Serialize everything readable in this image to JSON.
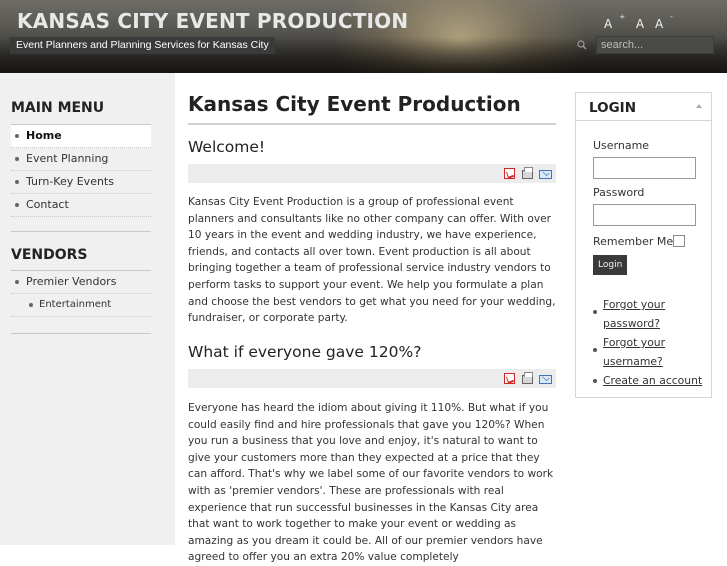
{
  "header": {
    "site_title": "KANSAS CITY EVENT PRODUCTION",
    "slogan": "Event Planners and Planning Services for Kansas City",
    "font_controls": {
      "increase": "A",
      "increase_sup": "+",
      "reset": "A",
      "decrease": "A",
      "decrease_sup": "-"
    },
    "search": {
      "placeholder": "search..."
    }
  },
  "left": {
    "main_menu": {
      "title": "MAIN MENU",
      "items": [
        {
          "label": "Home",
          "active": true
        },
        {
          "label": "Event Planning"
        },
        {
          "label": "Turn-Key Events"
        },
        {
          "label": "Contact"
        }
      ]
    },
    "vendors": {
      "title": "VENDORS",
      "items": [
        {
          "label": "Premier Vendors"
        },
        {
          "label": "Entertainment",
          "sub": true
        }
      ]
    }
  },
  "main": {
    "page_title": "Kansas City Event Production",
    "articles": [
      {
        "title": "Welcome!",
        "tools": [
          "pdf-icon",
          "print-icon",
          "email-icon"
        ],
        "text": "Kansas City Event Production is a group of professional event planners and consultants like no other company can offer. With over 10 years in the event and wedding industry, we have experience, friends, and contacts all over town. Event production is all about bringing together a team of professional service industry vendors to perform tasks to support your event. We help you formulate a plan and choose the best vendors to get what you need for your wedding, fundraiser, or corporate party."
      },
      {
        "title": "What if everyone gave 120%?",
        "tools": [
          "pdf-icon",
          "print-icon",
          "email-icon"
        ],
        "text": "Everyone has heard the idiom about giving it 110%. But what if you could easily find and hire professionals that gave you 120%? When you run a business that you love and enjoy, it's natural to want to give your customers more than they expected at a price that they can afford. That's why we label some of our favorite vendors to work with as 'premier vendors'. These are professionals with real experience that run successful businesses in the Kansas City area that want to work together to make your event or wedding as amazing as you dream it could be. All of our premier vendors have agreed to offer you an extra 20% value completely"
      }
    ]
  },
  "login": {
    "title": "LOGIN",
    "username_label": "Username",
    "password_label": "Password",
    "remember_label": "Remember Me",
    "button_label": "Login",
    "links": [
      {
        "line1": "Forgot your",
        "line2": "password?"
      },
      {
        "line1": "Forgot your",
        "line2": "username?"
      },
      {
        "line1": "Create an account"
      }
    ]
  }
}
